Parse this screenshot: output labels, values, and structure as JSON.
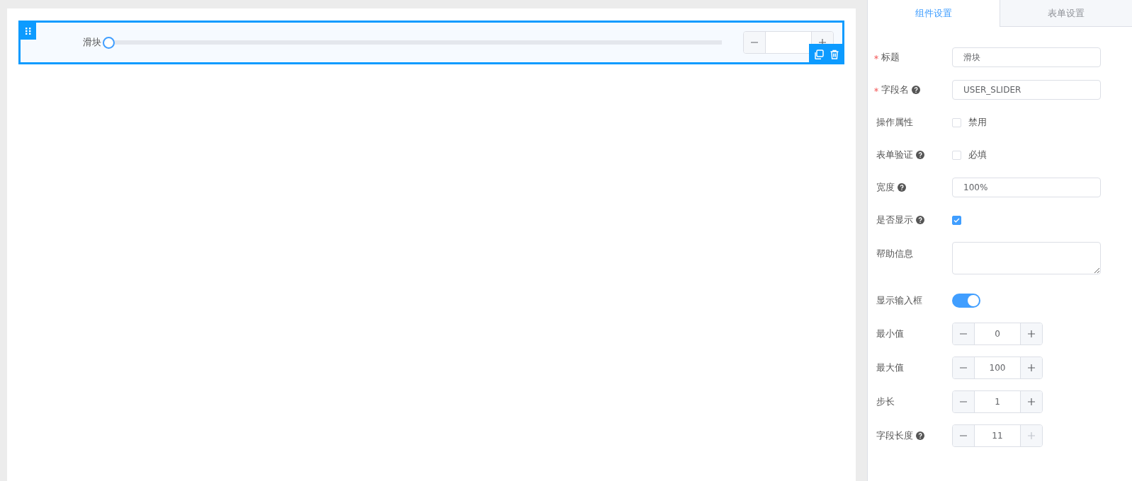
{
  "canvas": {
    "widget": {
      "label": "滑块",
      "selected": true,
      "slider": {
        "level": 0
      },
      "show_input": true
    }
  },
  "tabs": [
    {
      "label": "组件设置",
      "selected": true
    },
    {
      "label": "表单设置",
      "selected": false
    }
  ],
  "fields": [
    {
      "kind": "text",
      "label": "标题",
      "required": true,
      "help": false,
      "value": "滑块"
    },
    {
      "kind": "text",
      "label": "字段名",
      "required": true,
      "help": true,
      "value": "USER_SLIDER"
    },
    {
      "kind": "checkbox",
      "label": "操作属性",
      "required": false,
      "help": false,
      "option": "禁用",
      "checked": false
    },
    {
      "kind": "checkbox",
      "label": "表单验证",
      "required": false,
      "help": true,
      "option": "必填",
      "checked": false
    },
    {
      "kind": "text",
      "label": "宽度",
      "required": false,
      "help": true,
      "value": "100%"
    },
    {
      "kind": "checkbox",
      "label": "是否显示",
      "required": false,
      "help": true,
      "checked": true
    },
    {
      "kind": "textarea",
      "label": "帮助信息",
      "required": false,
      "help": false
    },
    {
      "kind": "switch",
      "label": "显示输入框",
      "required": false,
      "help": false,
      "on": true
    },
    {
      "kind": "number",
      "label": "最小值",
      "required": false,
      "help": false,
      "value": "0",
      "increase_disabled": false
    },
    {
      "kind": "number",
      "label": "最大值",
      "required": false,
      "help": false,
      "value": "100",
      "increase_disabled": false
    },
    {
      "kind": "number",
      "label": "步长",
      "required": false,
      "help": false,
      "value": "1",
      "increase_disabled": false
    },
    {
      "kind": "number",
      "label": "字段长度",
      "required": false,
      "help": true,
      "value": "11",
      "increase_disabled": true
    }
  ]
}
